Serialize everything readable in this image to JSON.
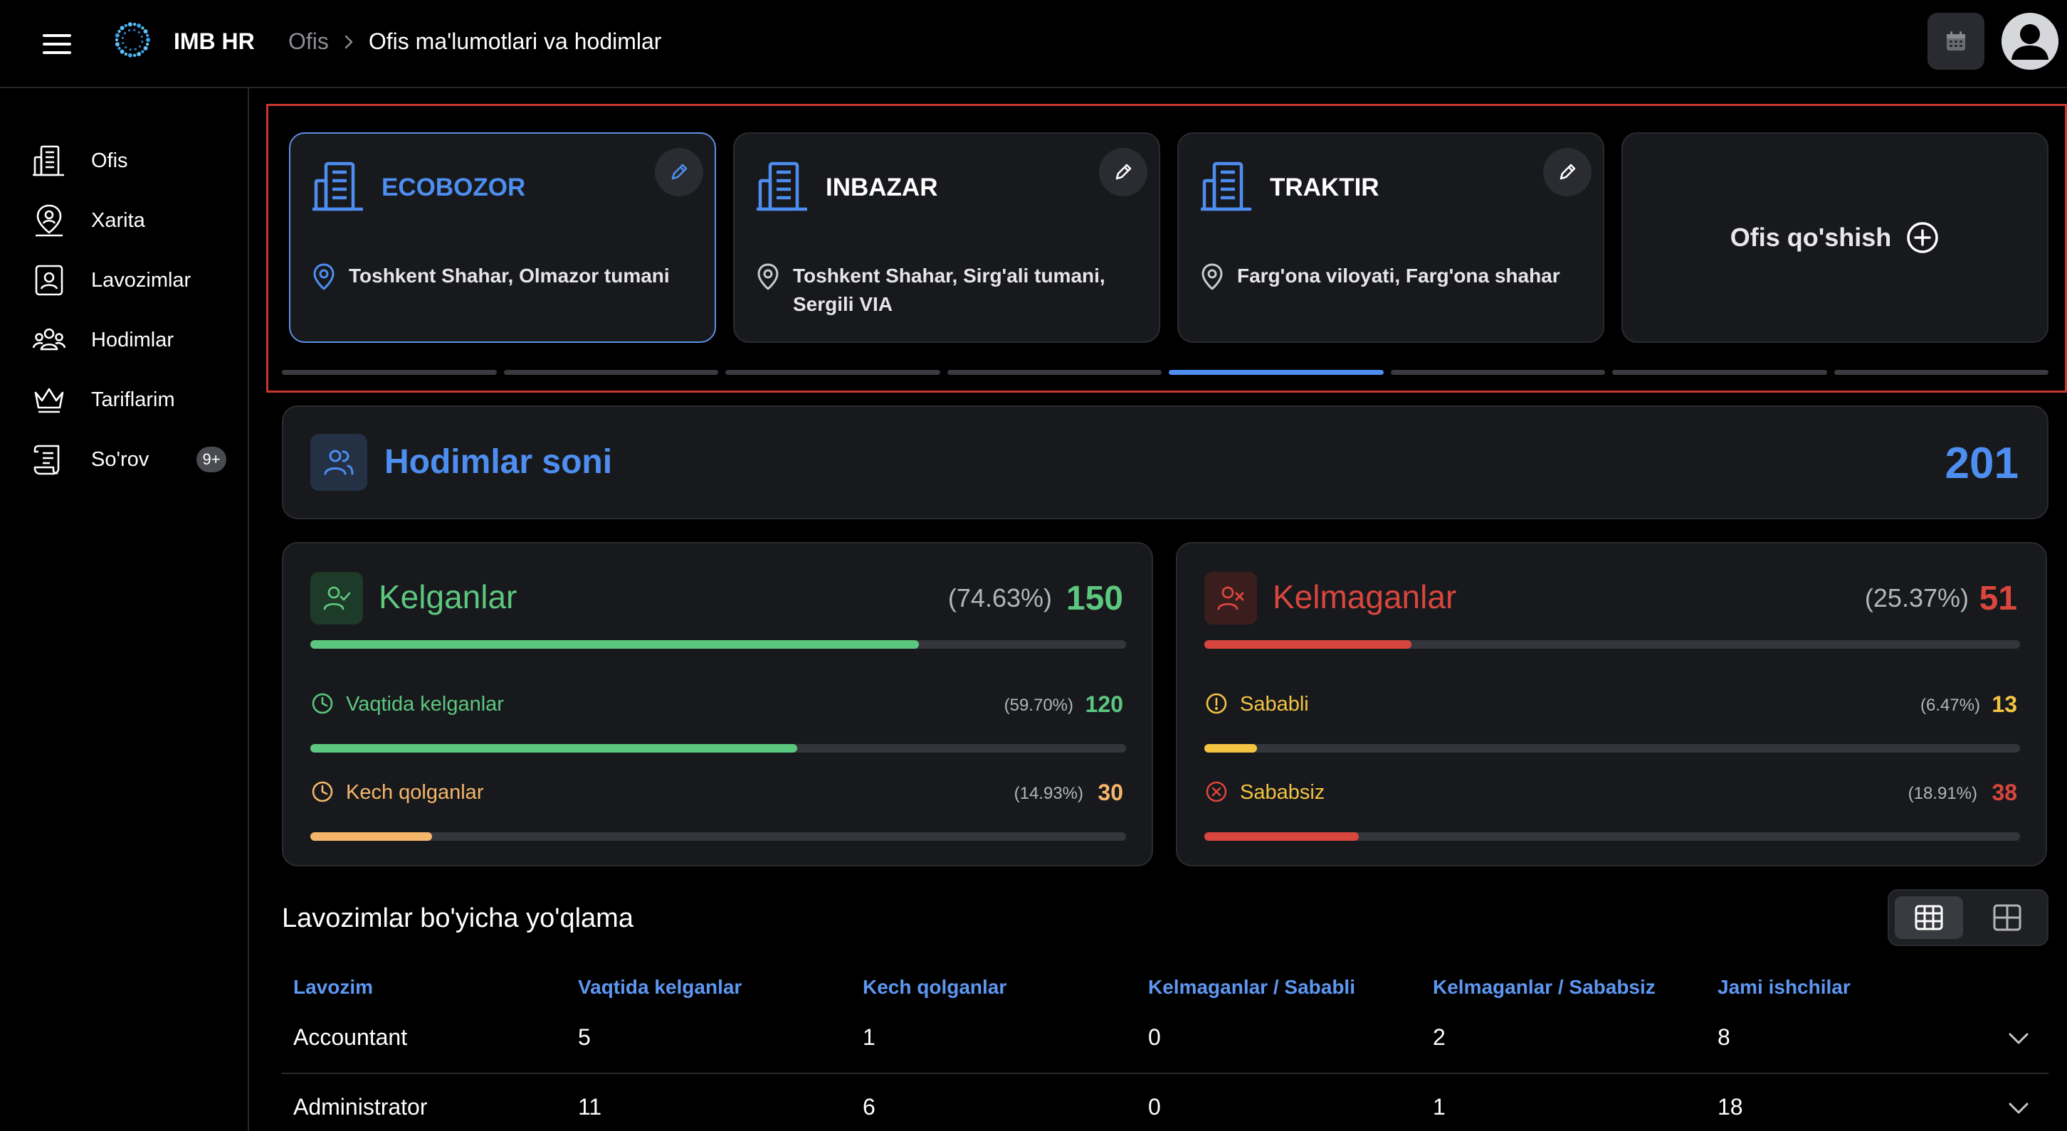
{
  "header": {
    "brand": "IMB HR",
    "breadcrumb_root": "Ofis",
    "breadcrumb_current": "Ofis ma'lumotlari va hodimlar",
    "icons": [
      "menu-icon",
      "logo-icon",
      "chevron-right-icon",
      "calendar-icon",
      "user-avatar-icon"
    ]
  },
  "sidebar": {
    "items": [
      {
        "label": "Ofis",
        "icon": "office-building-icon"
      },
      {
        "label": "Xarita",
        "icon": "map-pin-user-icon"
      },
      {
        "label": "Lavozimlar",
        "icon": "id-badge-icon"
      },
      {
        "label": "Hodimlar",
        "icon": "users-group-icon"
      },
      {
        "label": "Tariflarim",
        "icon": "crown-icon"
      },
      {
        "label": "So'rov",
        "icon": "scroll-icon",
        "badge": "9+"
      }
    ]
  },
  "offices": [
    {
      "name": "ECOBOZOR",
      "address": "Toshkent Shahar, Olmazor tumani",
      "active": true
    },
    {
      "name": "INBAZAR",
      "address": "Toshkent Shahar, Sirg'ali tumani, Sergili VIA",
      "active": false
    },
    {
      "name": "TRAKTIR",
      "address": "Farg'ona viloyati, Farg'ona shahar",
      "active": false
    }
  ],
  "add_office_label": "Ofis qo'shish",
  "carousel": {
    "count": 8,
    "active_index": 4
  },
  "headcount": {
    "title": "Hodimlar soni",
    "count": "201"
  },
  "present": {
    "title": "Kelganlar",
    "percent": "(74.63%)",
    "count": "150",
    "fraction": 0.7463,
    "color": "#5cc77f",
    "sub": [
      {
        "label": "Vaqtida kelganlar",
        "percent": "(59.70%)",
        "count": "120",
        "fraction": 0.597,
        "color": "#5cc77f",
        "icon": "clock-icon"
      },
      {
        "label": "Kech qolganlar",
        "percent": "(14.93%)",
        "count": "30",
        "fraction": 0.1493,
        "color": "#f5b66b",
        "icon": "clock-icon"
      }
    ]
  },
  "absent": {
    "title": "Kelmaganlar",
    "percent": "(25.37%)",
    "count": "51",
    "fraction": 0.2537,
    "color": "#d9463d",
    "sub": [
      {
        "label": "Sababli",
        "percent": "(6.47%)",
        "count": "13",
        "fraction": 0.0647,
        "color": "#f2c442",
        "icon": "alert-circle-icon"
      },
      {
        "label": "Sababsiz",
        "percent": "(18.91%)",
        "count": "38",
        "fraction": 0.1891,
        "color": "#d9463d",
        "icon": "x-circle-icon"
      }
    ]
  },
  "table": {
    "title": "Lavozimlar bo'yicha yo'qlama",
    "columns": [
      "Lavozim",
      "Vaqtida kelganlar",
      "Kech qolganlar",
      "Kelmaganlar / Sababli",
      "Kelmaganlar / Sababsiz",
      "Jami ishchilar"
    ],
    "rows": [
      [
        "Accountant",
        "5",
        "1",
        "0",
        "2",
        "8"
      ],
      [
        "Administrator",
        "11",
        "6",
        "0",
        "1",
        "18"
      ]
    ]
  }
}
